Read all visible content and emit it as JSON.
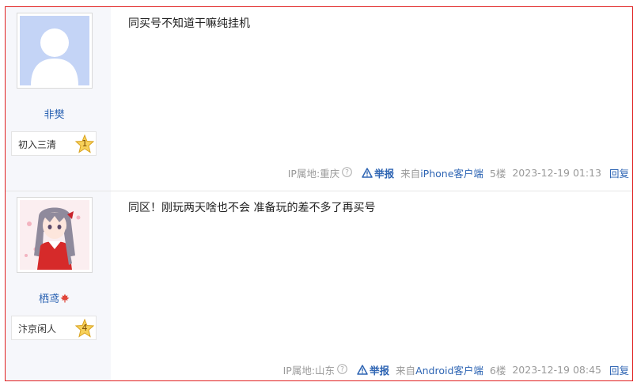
{
  "posts": [
    {
      "username": "非樊",
      "level_name": "初入三清",
      "level_num": "1",
      "content": "同买号不知道干嘛纯挂机",
      "ip_location": "IP属地:重庆",
      "report_label": "举报",
      "from_prefix": "来自",
      "client": "iPhone客户端",
      "floor": "5楼",
      "time": "2023-12-19 01:13",
      "reply_label": "回复",
      "avatar_icon": "default-avatar-icon"
    },
    {
      "username": "栖鸢",
      "level_name": "汴京闲人",
      "level_num": "4",
      "content": "同区！刚玩两天啥也不会 准备玩的差不多了再买号",
      "ip_location": "IP属地:山东",
      "report_label": "举报",
      "from_prefix": "来自",
      "client": "Android客户端",
      "floor": "6楼",
      "time": "2023-12-19 08:45",
      "reply_label": "回复",
      "avatar_icon": "anime-girl-avatar"
    }
  ],
  "colors": {
    "link": "#2d64b3",
    "muted": "#999999",
    "frame": "#e02020",
    "sidebar_bg": "#f6f7fb"
  }
}
